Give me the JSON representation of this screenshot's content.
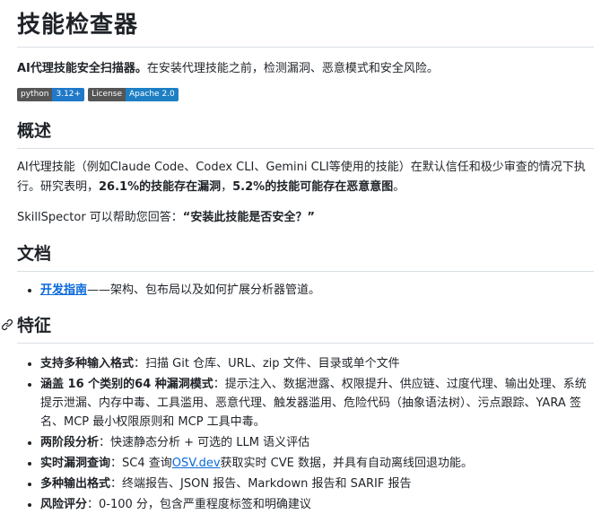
{
  "title": "技能检查器",
  "intro": {
    "bold": "AI代理技能安全扫描器。",
    "rest": "在安装代理技能之前，检测漏洞、恶意模式和安全风险。"
  },
  "badges": [
    {
      "label": "python",
      "value": "3.12+",
      "color": "#1f78c8"
    },
    {
      "label": "License",
      "value": "Apache 2.0",
      "color": "#1e7fc4"
    }
  ],
  "overview": {
    "heading": "概述",
    "p1_a": "AI代理技能（例如Claude Code、Codex CLI、Gemini CLI等使用的技能）在默认信任和极少审查的情况下执行。研究表明，",
    "p1_b1": "26.1%的技能存在漏洞",
    "p1_sep": "，",
    "p1_b2": "5.2%的技能可能存在恶意意图",
    "p1_end": "。",
    "p2_a": "SkillSpector 可以帮助您回答：",
    "p2_b": "“安装此技能是否安全？”"
  },
  "docs": {
    "heading": "文档",
    "link": "开发指南",
    "rest": "——架构、包布局以及如何扩展分析器管道。"
  },
  "features": {
    "heading": "特征",
    "items": [
      {
        "bold": "支持多种输入格式",
        "rest": "：扫描 Git 仓库、URL、zip 文件、目录或单个文件"
      },
      {
        "bold": "涵盖 16 个类别的64 种漏洞模式",
        "rest": "：提示注入、数据泄露、权限提升、供应链、过度代理、输出处理、系统提示泄漏、内存中毒、工具滥用、恶意代理、触发器滥用、危险代码（抽象语法树）、污点跟踪、YARA 签名、MCP 最小权限原则和 MCP 工具中毒。"
      },
      {
        "bold": "两阶段分析",
        "rest": "：快速静态分析 + 可选的 LLM 语义评估"
      },
      {
        "bold": "实时漏洞查询",
        "rest_a": "：SC4 查询",
        "link": "OSV.dev",
        "rest": "获取实时 CVE 数据，并具有自动离线回退功能。"
      },
      {
        "bold": "多种输出格式",
        "rest": "：终端报告、JSON 报告、Markdown 报告和 SARIF 报告"
      },
      {
        "bold": "风险评分",
        "rest": "：0-100 分，包含严重程度标签和明确建议"
      }
    ]
  },
  "icons": {
    "anchor": "link-icon"
  }
}
